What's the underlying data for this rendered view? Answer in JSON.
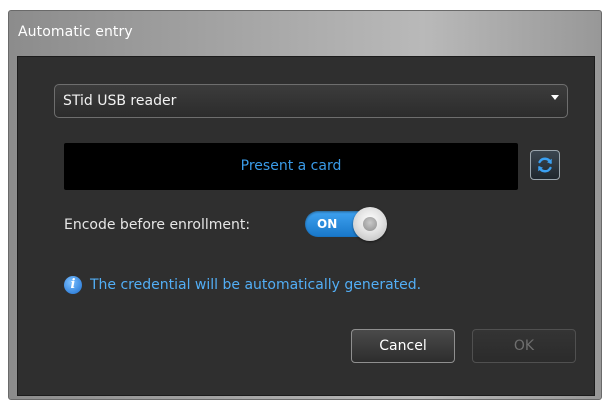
{
  "dialog": {
    "title": "Automatic entry",
    "reader_select": {
      "selected_value": "STid USB reader"
    },
    "present_card_text": "Present a card",
    "refresh_icon": "refresh-icon",
    "encode": {
      "label": "Encode before enrollment:",
      "toggle_state": "ON"
    },
    "info": {
      "icon": "info-icon",
      "icon_glyph": "i",
      "text": "The credential will be automatically generated."
    },
    "buttons": {
      "cancel_label": "Cancel",
      "ok_label": "OK"
    },
    "colors": {
      "accent_blue": "#3a9be8",
      "panel_bg": "#2f2f2f",
      "toggle_on": "#2a8fe0"
    }
  }
}
